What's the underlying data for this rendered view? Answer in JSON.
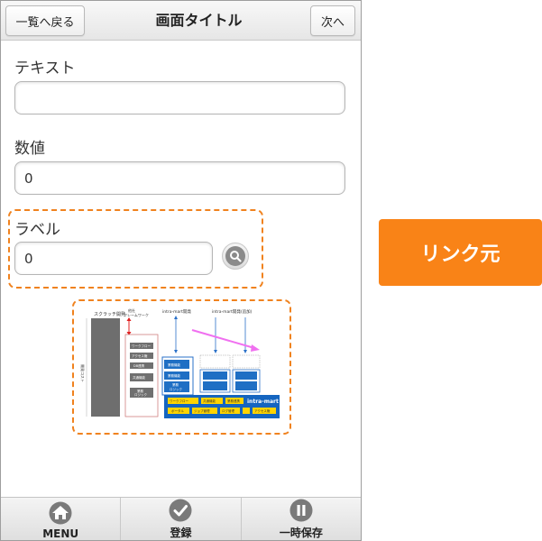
{
  "header": {
    "back_label": "一覧へ戻る",
    "title": "画面タイトル",
    "next_label": "次へ"
  },
  "form": {
    "text_label": "テキスト",
    "text_value": "",
    "number_label": "数値",
    "number_value": "0",
    "label_label": "ラベル",
    "label_value": "0"
  },
  "image": {
    "icon": "diagram-image",
    "texts": {
      "scratch": "スクラッチ開発",
      "framework": "他社\nフレームワーク",
      "im_dev": "intra-mart開発",
      "im_dev2": "intra-mart開発(追加)",
      "cost": "開発コスト",
      "brand": "intra-mart",
      "workflow": "ワークフロー",
      "access": "アクセス権",
      "db": "DB連携",
      "common": "共通機能",
      "portal": "ポータル",
      "job": "ジョブ管理",
      "log": "ログ管理",
      "business": "業務機能",
      "apps": "業務\nロジック"
    }
  },
  "link_box": {
    "label": "リンク元"
  },
  "footer": {
    "tabs": [
      {
        "label": "MENU",
        "icon": "home-icon"
      },
      {
        "label": "登録",
        "icon": "check-icon"
      },
      {
        "label": "一時保存",
        "icon": "pause-icon"
      }
    ]
  },
  "colors": {
    "accent": "#f98317",
    "dash": "#f0821e"
  }
}
